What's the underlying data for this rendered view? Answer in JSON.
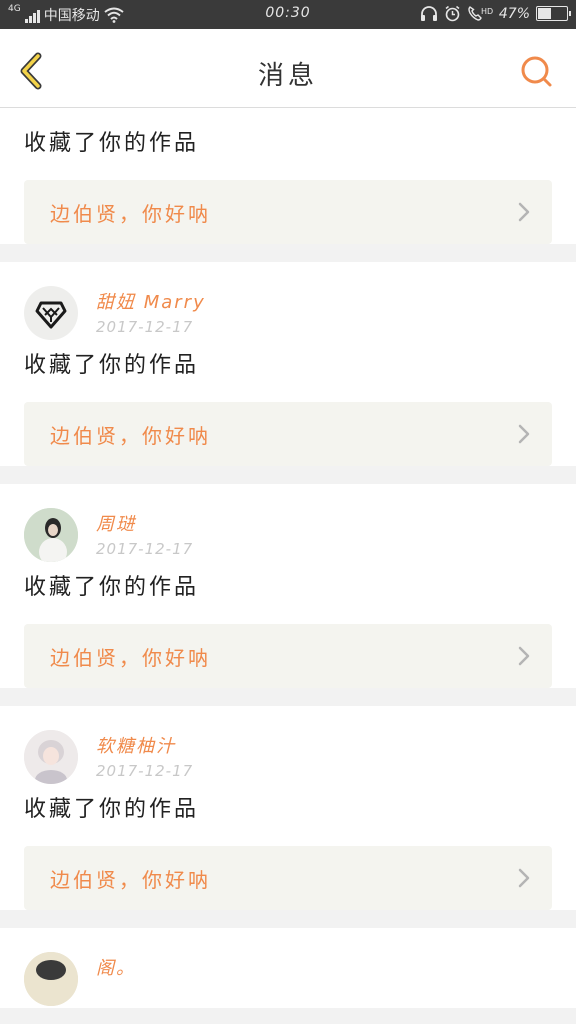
{
  "status_bar": {
    "network": "4G",
    "carrier": "中国移动",
    "time": "00:30",
    "battery": "47%",
    "battery_level": 0.47,
    "icons": [
      "signal-icon",
      "wifi-icon",
      "headset-icon",
      "alarm-icon",
      "call-hd-icon",
      "battery-icon"
    ]
  },
  "header": {
    "title": "消息",
    "back_icon": "chevron-left-icon",
    "search_icon": "search-icon",
    "accent": "#f08a4b"
  },
  "messages": [
    {
      "user": "",
      "date": "",
      "action": "收藏了你的作品",
      "work_title": "边伯贤，你好呐"
    },
    {
      "user": "甜妞  Marry",
      "date": "2017-12-17",
      "action": "收藏了你的作品",
      "work_title": "边伯贤，你好呐"
    },
    {
      "user": "周琎",
      "date": "2017-12-17",
      "action": "收藏了你的作品",
      "work_title": "边伯贤，你好呐"
    },
    {
      "user": "软糖柚汁",
      "date": "2017-12-17",
      "action": "收藏了你的作品",
      "work_title": "边伯贤，你好呐"
    },
    {
      "user": "阁。",
      "date": "",
      "action": "",
      "work_title": ""
    }
  ]
}
